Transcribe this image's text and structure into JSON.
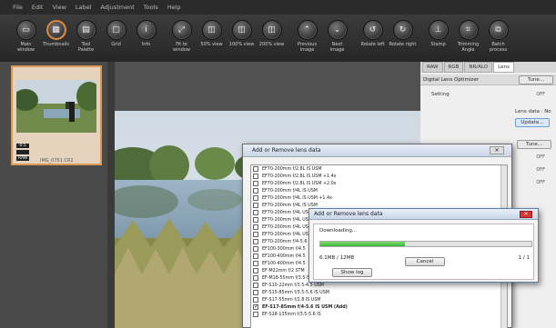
{
  "menubar": [
    "File",
    "Edit",
    "View",
    "Label",
    "Adjustment",
    "Tools",
    "Help"
  ],
  "toolbar": [
    {
      "label": "Main\nwindow",
      "icon": "main-window-icon",
      "glyph": "▭"
    },
    {
      "label": "Thumbnails",
      "icon": "thumbnails-icon",
      "glyph": "▦",
      "active": true
    },
    {
      "label": "Tool\nPalette",
      "icon": "tool-palette-icon",
      "glyph": "▤"
    },
    {
      "label": "Grid",
      "icon": "grid-icon",
      "glyph": "▢"
    },
    {
      "label": "Info",
      "icon": "info-icon",
      "glyph": "i"
    },
    {
      "label": "Fit to\nwindow",
      "icon": "fit-to-window-icon",
      "glyph": "⤢",
      "gap": true
    },
    {
      "label": "50% view",
      "icon": "view-50-icon",
      "glyph": "◫"
    },
    {
      "label": "100% view",
      "icon": "view-100-icon",
      "glyph": "◫"
    },
    {
      "label": "200% view",
      "icon": "view-200-icon",
      "glyph": "◫"
    },
    {
      "label": "Previous\nimage",
      "icon": "previous-image-icon",
      "glyph": "⌃",
      "gap": true
    },
    {
      "label": "Next\nimage",
      "icon": "next-image-icon",
      "glyph": "⌄"
    },
    {
      "label": "Rotate left",
      "icon": "rotate-left-icon",
      "glyph": "↺",
      "gap": true
    },
    {
      "label": "Rotate right",
      "icon": "rotate-right-icon",
      "glyph": "↻"
    },
    {
      "label": "Stamp",
      "icon": "stamp-icon",
      "glyph": "⊥",
      "gap": true
    },
    {
      "label": "Trimming\nAngle",
      "icon": "trimming-icon",
      "glyph": "⌗"
    },
    {
      "label": "Batch\nprocess",
      "icon": "batch-process-icon",
      "glyph": "⧉"
    }
  ],
  "thumbnail": {
    "filename": "IMG_0751.CR2",
    "badges": [
      "-0.5",
      "",
      "RAW"
    ]
  },
  "right_panel": {
    "tabs": [
      "RAW",
      "RGB",
      "NR/ALO",
      "Lens"
    ],
    "selected_tab": "Lens",
    "section": "Digital Lens Optimizer",
    "tune_label": "Tune...",
    "setting_label": "Setting",
    "setting_value": "OFF",
    "lens_data_label": "Lens data : No",
    "update_label": "Update...",
    "tune2_label": "Tune...",
    "off_values": [
      "OFF",
      "OFF",
      "OFF"
    ]
  },
  "lens_dialog": {
    "title": "Add or Remove lens data",
    "close": "✕",
    "lenses": [
      {
        "name": "EF70-200mm f/2.8L IS USM",
        "checked": false
      },
      {
        "name": "EF70-200mm f/2.8L IS USM +1.4x",
        "checked": false
      },
      {
        "name": "EF70-200mm f/2.8L IS USM +2.0x",
        "checked": false
      },
      {
        "name": "EF70-200mm f/4L IS USM",
        "checked": false
      },
      {
        "name": "EF70-200mm f/4L IS USM +1.4x",
        "checked": false
      },
      {
        "name": "EF70-200mm f/4L IS USM",
        "checked": false
      },
      {
        "name": "EF70-200mm f/4L USM",
        "checked": false
      },
      {
        "name": "EF70-200mm f/4L USM",
        "checked": false
      },
      {
        "name": "EF70-200mm f/4L USM",
        "checked": false
      },
      {
        "name": "EF70-200mm f/4L USM",
        "checked": false
      },
      {
        "name": "EF70-200mm f/4-5.6",
        "checked": false
      },
      {
        "name": "EF100-300mm f/4.5",
        "checked": false
      },
      {
        "name": "EF100-400mm f/4.5",
        "checked": false
      },
      {
        "name": "EF100-400mm f/4.5",
        "checked": false
      },
      {
        "name": "EF-M22mm f/2 STM",
        "checked": false
      },
      {
        "name": "EF-M18-55mm f/3.5-5.6 IS STM",
        "checked": false
      },
      {
        "name": "EF-S10-22mm f/3.5-4.5 USM",
        "checked": false
      },
      {
        "name": "EF-S15-85mm f/3.5-5.6 IS USM",
        "checked": false
      },
      {
        "name": "EF-S17-55mm f/2.8 IS USM",
        "checked": false
      },
      {
        "name": "EF-S17-85mm f/4-5.6 IS USM (Add)",
        "checked": true,
        "bold": true
      },
      {
        "name": "EF-S18-135mm f/3.5-5.6 IS",
        "checked": false
      }
    ]
  },
  "download_dialog": {
    "title": "Add or Remove lens data",
    "close": "✕",
    "status": "Downloading...",
    "progress": 0.4,
    "size": "6.1MB / 12MB",
    "count": "1 / 1",
    "cancel": "Cancel",
    "show_log": "Show log"
  }
}
